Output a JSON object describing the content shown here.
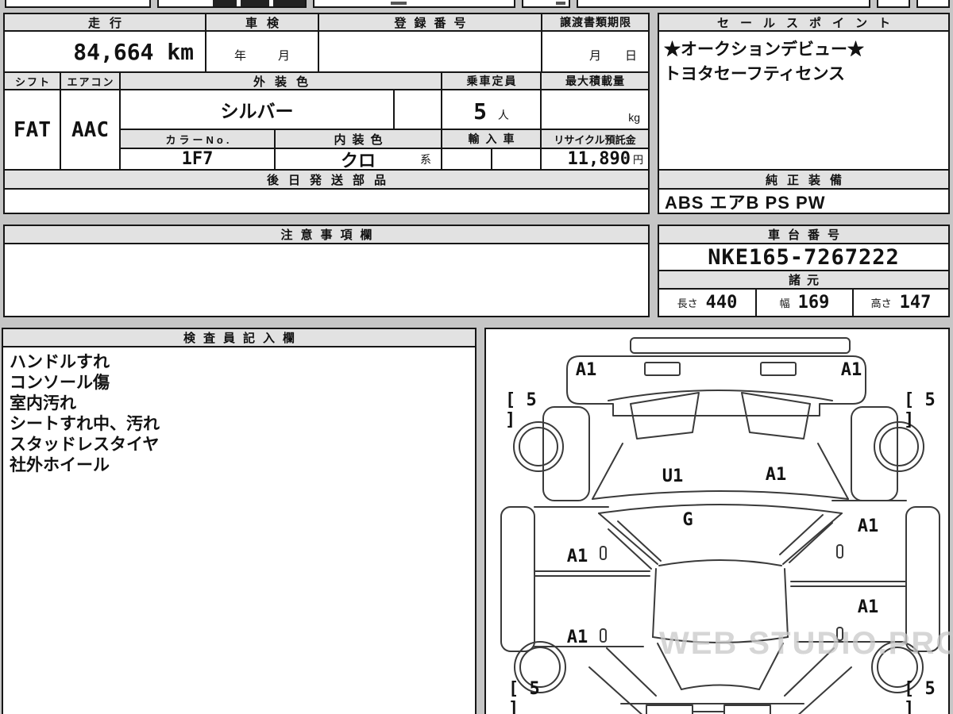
{
  "table": {
    "mileage_header": "走行",
    "mileage_value": "84,664 km",
    "inspection_header": "車検",
    "inspection_year": "年",
    "inspection_month": "月",
    "registration_header": "登録番号",
    "transfer_header": "譲渡書類期限",
    "transfer_month": "月",
    "transfer_day": "日",
    "shift_header": "シフト",
    "shift_value": "FAT",
    "aircon_header": "エアコン",
    "aircon_value": "AAC",
    "exterior_header": "外装色",
    "exterior_value": "シルバー",
    "capacity_header": "乗車定員",
    "capacity_value": "5",
    "capacity_unit": "人",
    "maxload_header": "最大積載量",
    "maxload_unit": "kg",
    "colorno_header": "カラーNo.",
    "colorno_value": "1F7",
    "interior_header": "内装色",
    "interior_value": "クロ",
    "interior_suffix": "系",
    "import_header": "輸入車",
    "recycle_header": "リサイクル預託金",
    "recycle_value": "11,890",
    "recycle_unit": "円",
    "later_parts_header": "後日発送部品"
  },
  "sales_point": {
    "header": "セールスポイント",
    "lines": [
      "★オークションデビュー★",
      "トヨタセーフティセンス"
    ]
  },
  "equipment": {
    "header": "純正装備",
    "value": "ABS エアB PS PW"
  },
  "notes": {
    "header": "注意事項欄"
  },
  "chassis": {
    "header": "車台番号",
    "value": "NKE165-7267222"
  },
  "specs": {
    "header": "諸元",
    "length_label": "長さ",
    "length_value": "440",
    "width_label": "幅",
    "width_value": "169",
    "height_label": "高さ",
    "height_value": "147"
  },
  "inspector": {
    "header": "検査員記入欄",
    "lines": [
      "ハンドルすれ",
      "コンソール傷",
      "室内汚れ",
      "シートすれ中、汚れ",
      "スタッドレスタイヤ",
      "社外ホイール"
    ]
  },
  "diagram": {
    "front_left": "A1",
    "front_right": "A1",
    "hood_left": "U1",
    "hood_right": "A1",
    "cowl": "G",
    "door_left_front": "A1",
    "door_left_rear": "A1",
    "door_right_front": "A1",
    "door_right_rear": "A1",
    "tire_front_left": "[ 5 ]",
    "tire_front_right": "[ 5 ]",
    "tire_rear_left": "[ 5 ]",
    "tire_rear_right": "[ 5 ]",
    "watermark": "WEB STUDIO.PRO"
  }
}
